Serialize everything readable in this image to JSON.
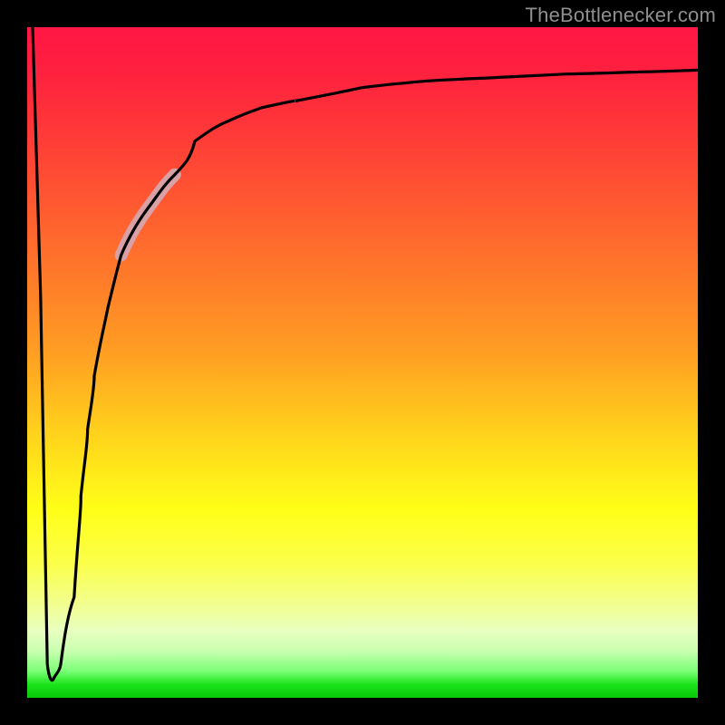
{
  "attribution": "TheBottlenecker.com",
  "chart_data": {
    "type": "line",
    "title": "",
    "xlabel": "",
    "ylabel": "",
    "xlim": [
      0,
      100
    ],
    "ylim": [
      0,
      100
    ],
    "note": "Abstract bottleneck curve over red-to-green vertical gradient. Values estimated from pixel positions (y = 100 - pixel_y_fraction*100). A highlighted pink segment lies roughly over x ≈ 14–22.",
    "highlight_range_x": [
      14,
      22
    ],
    "series": [
      {
        "name": "bottleneck-curve",
        "x": [
          0,
          2,
          3,
          4,
          5,
          6,
          7,
          8,
          9,
          10,
          12,
          14,
          16,
          18,
          20,
          22,
          25,
          30,
          35,
          40,
          50,
          60,
          70,
          80,
          90,
          100
        ],
        "y": [
          100,
          60,
          20,
          5,
          3,
          5,
          15,
          30,
          40,
          48,
          58,
          66,
          71,
          75,
          78,
          80,
          83,
          86,
          88,
          89,
          91,
          92,
          92.5,
          93,
          93.3,
          93.6
        ]
      }
    ],
    "gradient_stops": [
      {
        "pos": 0,
        "color": "#ff1744"
      },
      {
        "pos": 16,
        "color": "#ff3a38"
      },
      {
        "pos": 32,
        "color": "#ff6a2d"
      },
      {
        "pos": 48,
        "color": "#ff9c23"
      },
      {
        "pos": 62,
        "color": "#ffd81b"
      },
      {
        "pos": 72,
        "color": "#ffff18"
      },
      {
        "pos": 86,
        "color": "#f2ff8f"
      },
      {
        "pos": 96,
        "color": "#7cff77"
      },
      {
        "pos": 100,
        "color": "#08c908"
      }
    ]
  },
  "colors": {
    "frame": "#000000",
    "curve": "#000000",
    "highlight": "#d9a0a6",
    "attribution_text": "#8f8f8f"
  }
}
